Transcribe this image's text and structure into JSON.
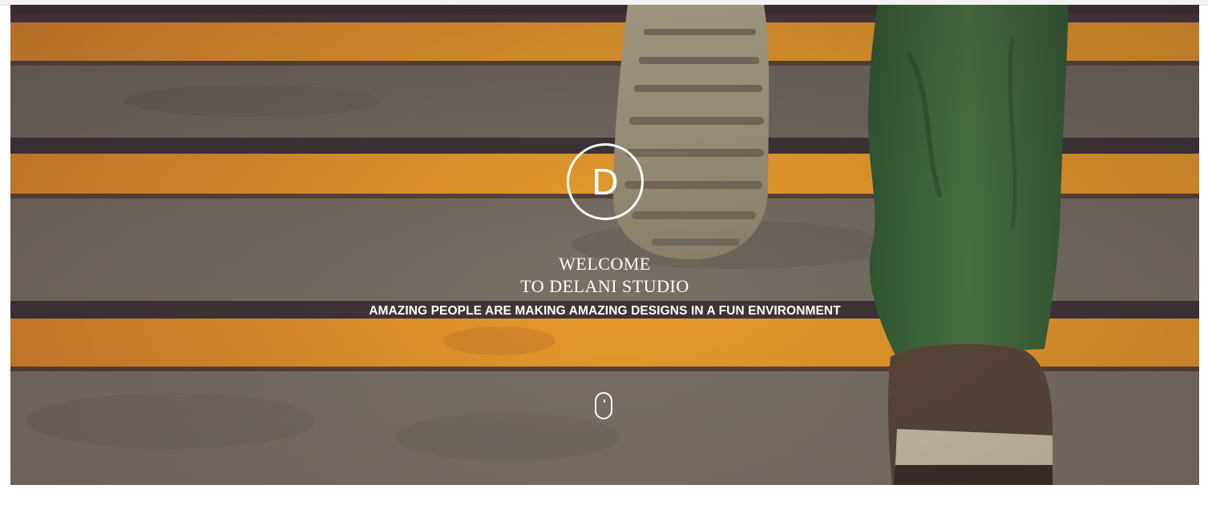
{
  "hero": {
    "background": "photo-stairs-walking-shoes",
    "logo_letter": "D",
    "headline_line1": "WELCOME",
    "headline_line2": "TO DELANI STUDIO",
    "tagline": "AMAZING PEOPLE ARE MAKING AMAZING DESIGNS IN A FUN ENVIRONMENT",
    "scroll_icon": "mouse-scroll-icon"
  },
  "colors": {
    "stair_stripe": "#f0a32a",
    "concrete": "#7b7466",
    "pants": "#3f6f3c",
    "text": "#ffffff"
  }
}
